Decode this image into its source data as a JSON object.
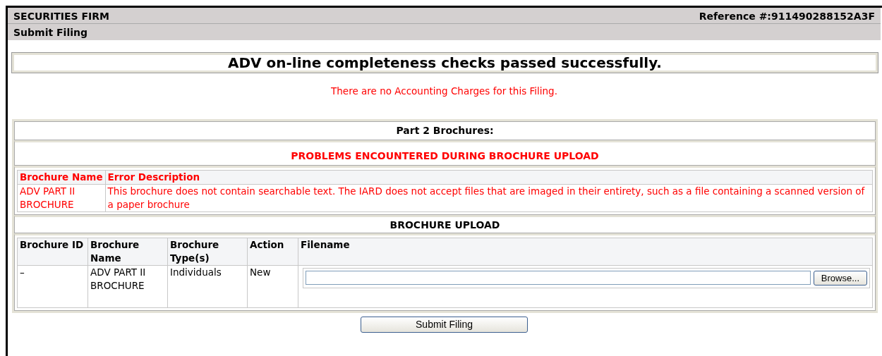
{
  "header": {
    "firm": "SECURITIES FIRM",
    "reference": "Reference #:911490288152A3F",
    "subtitle": "Submit Filing"
  },
  "status_title": "ADV on-line completeness checks passed successfully.",
  "accounting_note": "There are no Accounting Charges for this Filing.",
  "brochures": {
    "title": "Part 2 Brochures:",
    "problems": {
      "title": "PROBLEMS ENCOUNTERED DURING BROCHURE UPLOAD",
      "columns": [
        "Brochure Name",
        "Error Description"
      ],
      "rows": [
        [
          "ADV PART II BROCHURE",
          "This brochure does not contain searchable text. The IARD does not accept files that are imaged in their entirety, such as a file containing a scanned version of a paper brochure"
        ]
      ]
    },
    "upload": {
      "title": "BROCHURE UPLOAD",
      "columns": [
        "Brochure ID",
        "Brochure Name",
        "Brochure Type(s)",
        "Action",
        "Filename"
      ],
      "rows": [
        {
          "id": "–",
          "name": "ADV PART II BROCHURE",
          "types": "Individuals",
          "action": "New",
          "browse": "Browse..."
        }
      ]
    }
  },
  "submit": "Submit Filing"
}
